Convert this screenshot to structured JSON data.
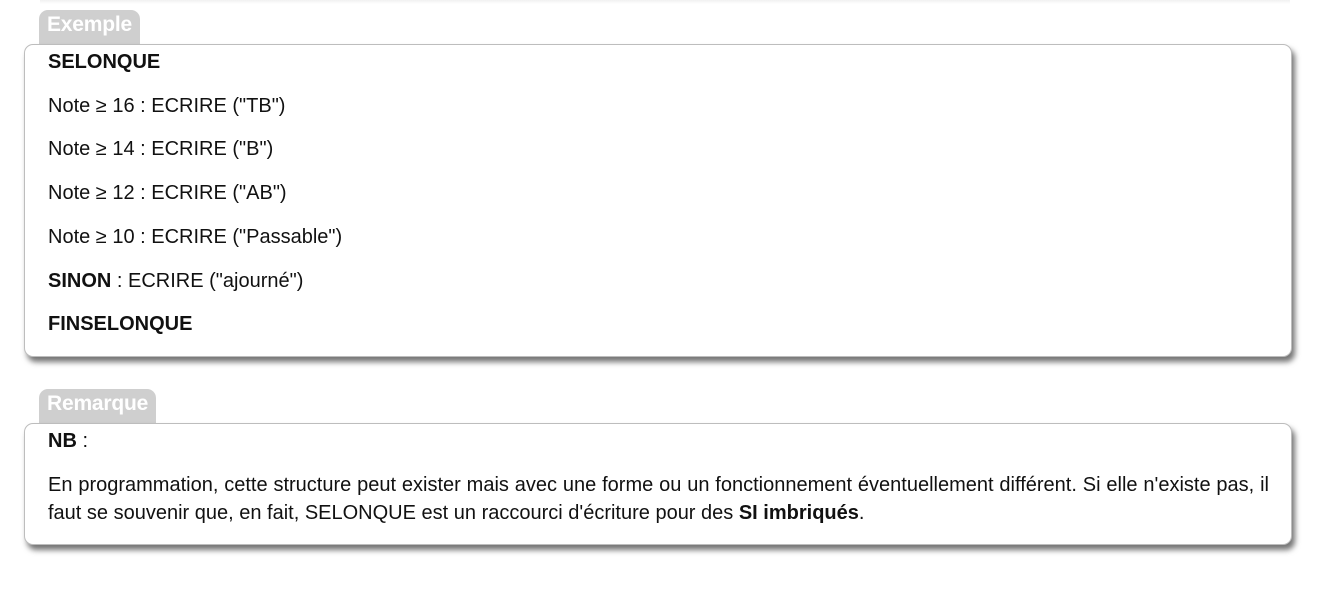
{
  "exemple": {
    "tab_label": "Exemple",
    "lines": {
      "selonque": "SELONQUE",
      "note16": "Note ≥ 16 : ECRIRE (\"TB\")",
      "note14": "Note ≥ 14 : ECRIRE (\"B\")",
      "note12": "Note ≥ 12 : ECRIRE (\"AB\")",
      "note10": "Note ≥ 10 : ECRIRE (\"Passable\")",
      "sinon_keyword": "SINON",
      "sinon_rest": " : ECRIRE (\"ajourné\")",
      "finselonque": "FINSELONQUE"
    }
  },
  "remarque": {
    "tab_label": "Remarque",
    "nb_label": "NB",
    "nb_colon": " :",
    "paragraph_text": "En programmation, cette structure peut exister mais avec une forme ou un fonctionnement éventuellement différent. Si elle n'existe pas, il faut se souvenir que, en fait, SELONQUE est un raccourci d'écriture pour des ",
    "paragraph_bold": "SI imbriqués",
    "paragraph_end": "."
  }
}
